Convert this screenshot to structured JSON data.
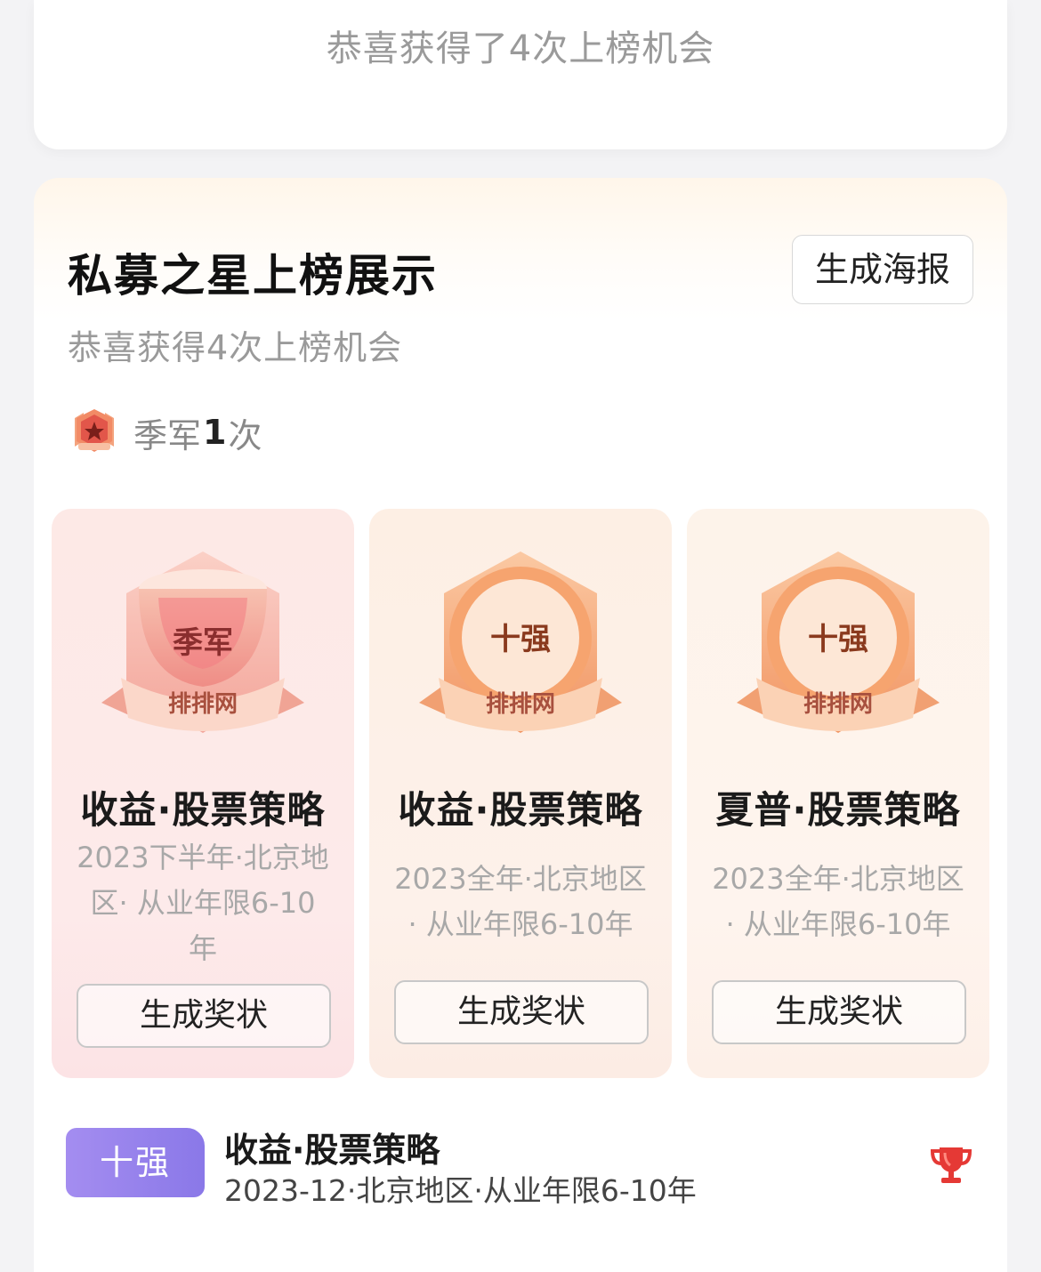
{
  "top_card": {
    "subtitle": "恭喜获得了4次上榜机会"
  },
  "section": {
    "title": "私募之星上榜展示",
    "poster_button": "生成海报",
    "subtitle": "恭喜获得4次上榜机会",
    "summary": {
      "label": "季军",
      "count": "1",
      "unit": "次"
    }
  },
  "awards": [
    {
      "badge_rank": "季军",
      "badge_brand": "排排网",
      "title": "收益·股票策略",
      "description": "2023下半年·北京地区· 从业年限6-10年",
      "button": "生成奖状"
    },
    {
      "badge_rank": "十强",
      "badge_brand": "排排网",
      "title": "收益·股票策略",
      "description": "2023全年·北京地区 · 从业年限6-10年",
      "button": "生成奖状"
    },
    {
      "badge_rank": "十强",
      "badge_brand": "排排网",
      "title": "夏普·股票策略",
      "description": "2023全年·北京地区 · 从业年限6-10年",
      "button": "生成奖状"
    }
  ],
  "records": [
    {
      "tag": "十强",
      "title": "收益·股票策略",
      "description": "2023-12·北京地区·从业年限6-10年",
      "icon": "trophy-icon"
    }
  ],
  "colors": {
    "tag_purple": "#9a86ee",
    "trophy_red": "#e53935",
    "badge_orange": "#f08a4b",
    "badge_pink": "#f26b7a"
  }
}
